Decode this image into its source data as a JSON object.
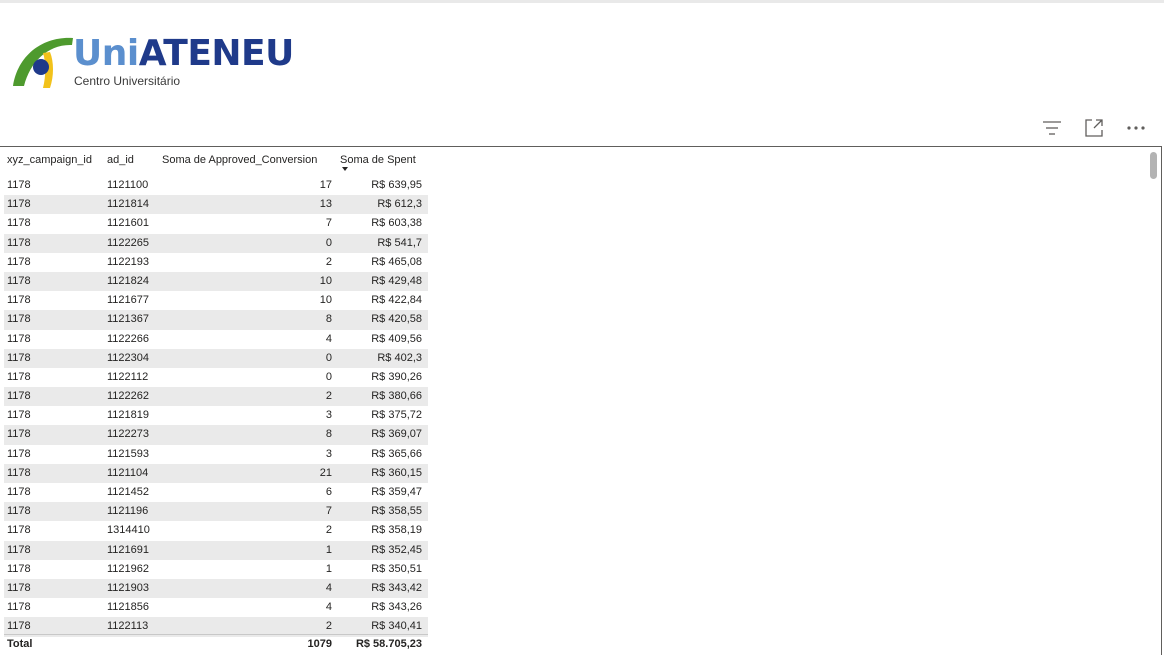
{
  "logo": {
    "brand_part1": "Uni",
    "brand_part2": "ATENEU",
    "subtitle": "Centro Universitário",
    "colors": {
      "green": "#4e9a2e",
      "yellow": "#f2c21b",
      "navy": "#1f3a8a",
      "light_blue": "#5b8fce"
    }
  },
  "visual_header": {
    "icons": [
      "filter-icon",
      "focus-mode-icon",
      "more-options-icon"
    ]
  },
  "table": {
    "columns": [
      "xyz_campaign_id",
      "ad_id",
      "Soma de Approved_Conversion",
      "Soma de Spent"
    ],
    "sorted_column": "Soma de Spent",
    "sort_direction": "descending",
    "rows": [
      [
        "1178",
        "1121100",
        "17",
        "R$ 639,95"
      ],
      [
        "1178",
        "1121814",
        "13",
        "R$ 612,3"
      ],
      [
        "1178",
        "1121601",
        "7",
        "R$ 603,38"
      ],
      [
        "1178",
        "1122265",
        "0",
        "R$ 541,7"
      ],
      [
        "1178",
        "1122193",
        "2",
        "R$ 465,08"
      ],
      [
        "1178",
        "1121824",
        "10",
        "R$ 429,48"
      ],
      [
        "1178",
        "1121677",
        "10",
        "R$ 422,84"
      ],
      [
        "1178",
        "1121367",
        "8",
        "R$ 420,58"
      ],
      [
        "1178",
        "1122266",
        "4",
        "R$ 409,56"
      ],
      [
        "1178",
        "1122304",
        "0",
        "R$ 402,3"
      ],
      [
        "1178",
        "1122112",
        "0",
        "R$ 390,26"
      ],
      [
        "1178",
        "1122262",
        "2",
        "R$ 380,66"
      ],
      [
        "1178",
        "1121819",
        "3",
        "R$ 375,72"
      ],
      [
        "1178",
        "1122273",
        "8",
        "R$ 369,07"
      ],
      [
        "1178",
        "1121593",
        "3",
        "R$ 365,66"
      ],
      [
        "1178",
        "1121104",
        "21",
        "R$ 360,15"
      ],
      [
        "1178",
        "1121452",
        "6",
        "R$ 359,47"
      ],
      [
        "1178",
        "1121196",
        "7",
        "R$ 358,55"
      ],
      [
        "1178",
        "1314410",
        "2",
        "R$ 358,19"
      ],
      [
        "1178",
        "1121691",
        "1",
        "R$ 352,45"
      ],
      [
        "1178",
        "1121962",
        "1",
        "R$ 350,51"
      ],
      [
        "1178",
        "1121903",
        "4",
        "R$ 343,42"
      ],
      [
        "1178",
        "1121856",
        "4",
        "R$ 343,26"
      ],
      [
        "1178",
        "1122113",
        "2",
        "R$ 340,41"
      ]
    ],
    "total": {
      "label": "Total",
      "conversion": "1079",
      "spent": "R$ 58.705,23"
    },
    "row_alt_color": "#eaeaea"
  }
}
